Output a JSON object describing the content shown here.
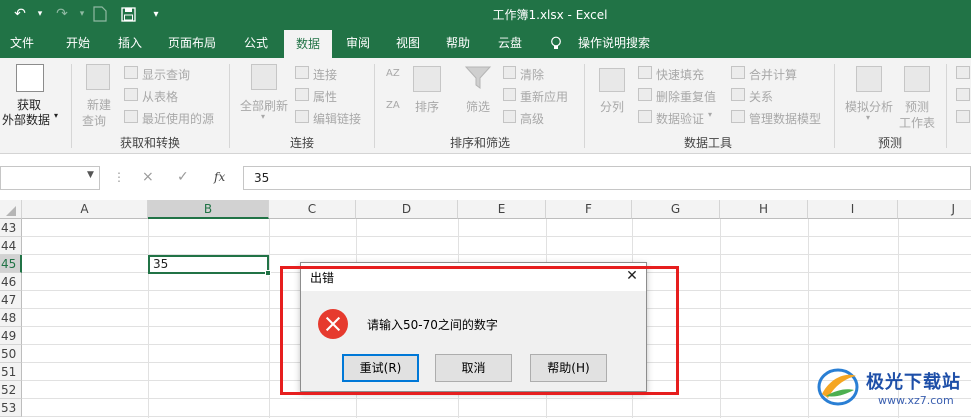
{
  "titlebar": {
    "title": "工作簿1.xlsx - Excel",
    "undo_icon": "undo-icon",
    "redo_icon": "redo-icon",
    "save_icon": "save-icon",
    "customize_icon": "customize-quick-access-icon"
  },
  "tabs": [
    {
      "label": "文件",
      "active": false
    },
    {
      "label": "开始",
      "active": false
    },
    {
      "label": "插入",
      "active": false
    },
    {
      "label": "页面布局",
      "active": false
    },
    {
      "label": "公式",
      "active": false
    },
    {
      "label": "数据",
      "active": true
    },
    {
      "label": "审阅",
      "active": false
    },
    {
      "label": "视图",
      "active": false
    },
    {
      "label": "帮助",
      "active": false
    },
    {
      "label": "云盘",
      "active": false
    },
    {
      "label": "操作说明搜索",
      "active": false
    }
  ],
  "ribbon": {
    "get_external_data": {
      "line1": "获取",
      "line2": "外部数据"
    },
    "new_query": {
      "line1": "新建",
      "line2": "查询"
    },
    "show_queries": "显示查询",
    "from_table": "从表格",
    "recent_sources": "最近使用的源",
    "group_get_transform": "获取和转换",
    "refresh_all": "全部刷新",
    "connections": "连接",
    "properties": "属性",
    "edit_links": "编辑链接",
    "group_connections": "连接",
    "sort_label": "排序",
    "filter_label": "筛选",
    "clear": "清除",
    "reapply": "重新应用",
    "advanced": "高级",
    "group_sort_filter": "排序和筛选",
    "text_to_columns": "分列",
    "flash_fill": "快速填充",
    "remove_duplicates": "删除重复值",
    "data_validation": "数据验证",
    "consolidate": "合并计算",
    "relationships": "关系",
    "manage_data_model": "管理数据模型",
    "group_data_tools": "数据工具",
    "what_if": "模拟分析",
    "forecast_sheet": {
      "line1": "预测",
      "line2": "工作表"
    },
    "group_forecast": "预测",
    "az_label": "AZ",
    "za_label": "ZA"
  },
  "formula_bar": {
    "cancel_icon": "×",
    "enter_icon": "✓",
    "fx_label": "fx",
    "value": "35"
  },
  "grid": {
    "columns": [
      "A",
      "B",
      "C",
      "D",
      "E",
      "F",
      "G",
      "H",
      "I",
      "J"
    ],
    "selected_column": "B",
    "rows": [
      "43",
      "44",
      "45",
      "46",
      "47",
      "48",
      "49",
      "50",
      "51",
      "52",
      "53"
    ],
    "selected_row": "45",
    "active_cell_value": "35"
  },
  "dialog": {
    "title": "出错",
    "close": "✕",
    "message": "请输入50-70之间的数字",
    "retry": "重试(R)",
    "cancel": "取消",
    "help": "帮助(H)"
  },
  "watermark": {
    "title": "极光下载站",
    "url": "www.xz7.com"
  },
  "colors": {
    "excel_green": "#217346",
    "error_red": "#e63a2e",
    "highlight_red": "#e61e1e"
  }
}
